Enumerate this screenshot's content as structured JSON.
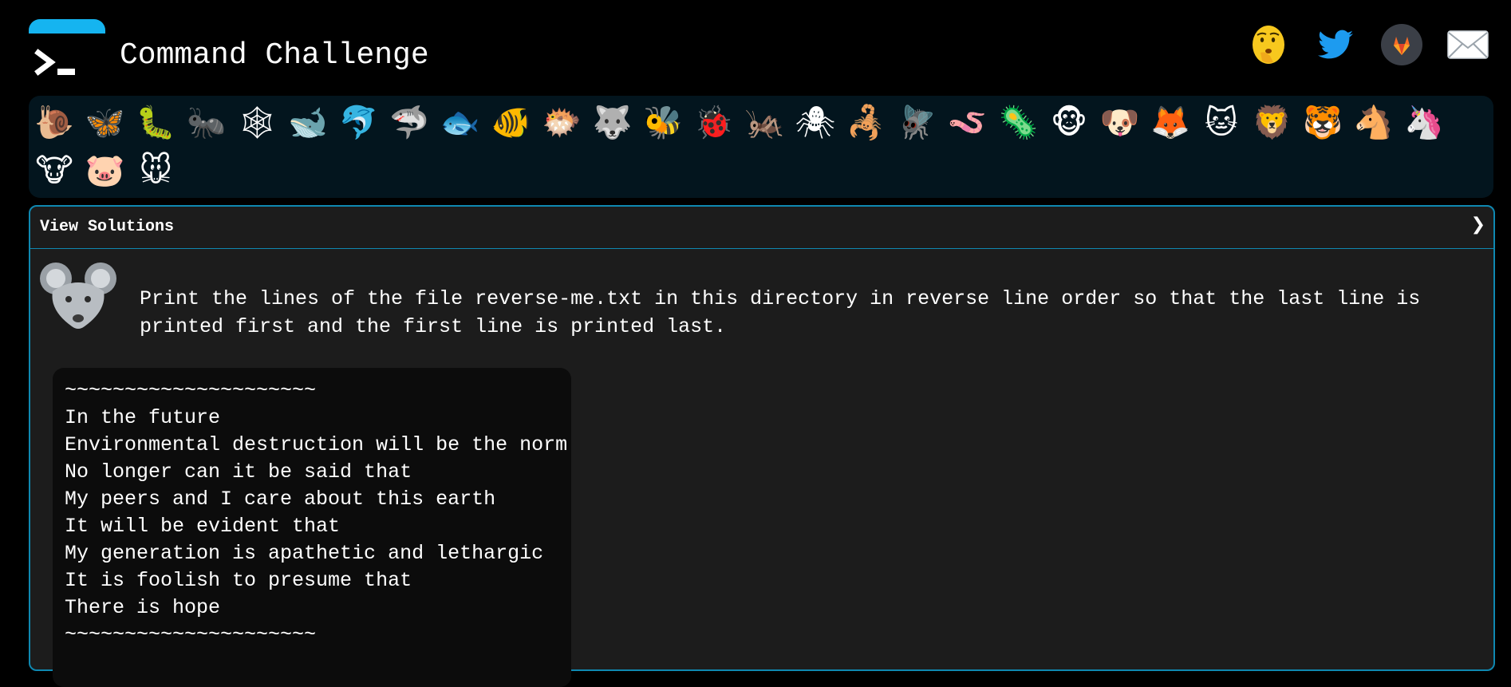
{
  "app": {
    "title": "Command Challenge"
  },
  "social_links": [
    {
      "name": "shushing-face",
      "icon": "shushing-face-icon"
    },
    {
      "name": "twitter",
      "icon": "twitter-icon"
    },
    {
      "name": "gitlab",
      "icon": "gitlab-icon"
    },
    {
      "name": "email",
      "icon": "envelope-icon"
    }
  ],
  "animals": [
    {
      "name": "snail",
      "glyph": "🐌"
    },
    {
      "name": "butterfly",
      "glyph": "🦋"
    },
    {
      "name": "caterpillar",
      "glyph": "🐛"
    },
    {
      "name": "ant",
      "glyph": "🐜"
    },
    {
      "name": "spider-web",
      "glyph": "🕸"
    },
    {
      "name": "whale",
      "glyph": "🐋"
    },
    {
      "name": "dolphin",
      "glyph": "🐬"
    },
    {
      "name": "shark",
      "glyph": "🦈"
    },
    {
      "name": "fish",
      "glyph": "🐟"
    },
    {
      "name": "tropical-fish",
      "glyph": "🐠"
    },
    {
      "name": "blowfish",
      "glyph": "🐡"
    },
    {
      "name": "wolf",
      "glyph": "🐺"
    },
    {
      "name": "bee",
      "glyph": "🐝"
    },
    {
      "name": "ladybug",
      "glyph": "🐞"
    },
    {
      "name": "cricket",
      "glyph": "🦗"
    },
    {
      "name": "spider",
      "glyph": "🕷"
    },
    {
      "name": "scorpion",
      "glyph": "🦂"
    },
    {
      "name": "fly",
      "glyph": "🪰"
    },
    {
      "name": "worm",
      "glyph": "🪱"
    },
    {
      "name": "microbe",
      "glyph": "🦠"
    },
    {
      "name": "monkey",
      "glyph": "🐵"
    },
    {
      "name": "dog",
      "glyph": "🐶"
    },
    {
      "name": "fox",
      "glyph": "🦊"
    },
    {
      "name": "cat",
      "glyph": "🐱"
    },
    {
      "name": "lion",
      "glyph": "🦁"
    },
    {
      "name": "tiger",
      "glyph": "🐯"
    },
    {
      "name": "horse",
      "glyph": "🐴"
    },
    {
      "name": "unicorn",
      "glyph": "🦄"
    },
    {
      "name": "cow",
      "glyph": "🐮"
    },
    {
      "name": "pig",
      "glyph": "🐷"
    },
    {
      "name": "mouse",
      "glyph": "🐭"
    }
  ],
  "panel": {
    "view_solutions_label": "View Solutions",
    "chevron": "❯",
    "challenge_text": "Print the lines of the file reverse-me.txt in this directory in reverse line order so that the last line is printed first and the first line is printed last.",
    "file_lines": [
      "~~~~~~~~~~~~~~~~~~~~~",
      "In the future",
      "Environmental destruction will be the norm",
      "No longer can it be said that",
      "My peers and I care about this earth",
      "It will be evident that",
      "My generation is apathetic and lethargic",
      "It is foolish to presume that",
      "There is hope",
      "~~~~~~~~~~~~~~~~~~~~~"
    ]
  },
  "colors": {
    "accent": "#15b4f0",
    "border": "#0f88b1",
    "strip_bg": "#03151e",
    "panel_bg": "#1c1c1c",
    "file_bg": "#0c0c0c"
  }
}
